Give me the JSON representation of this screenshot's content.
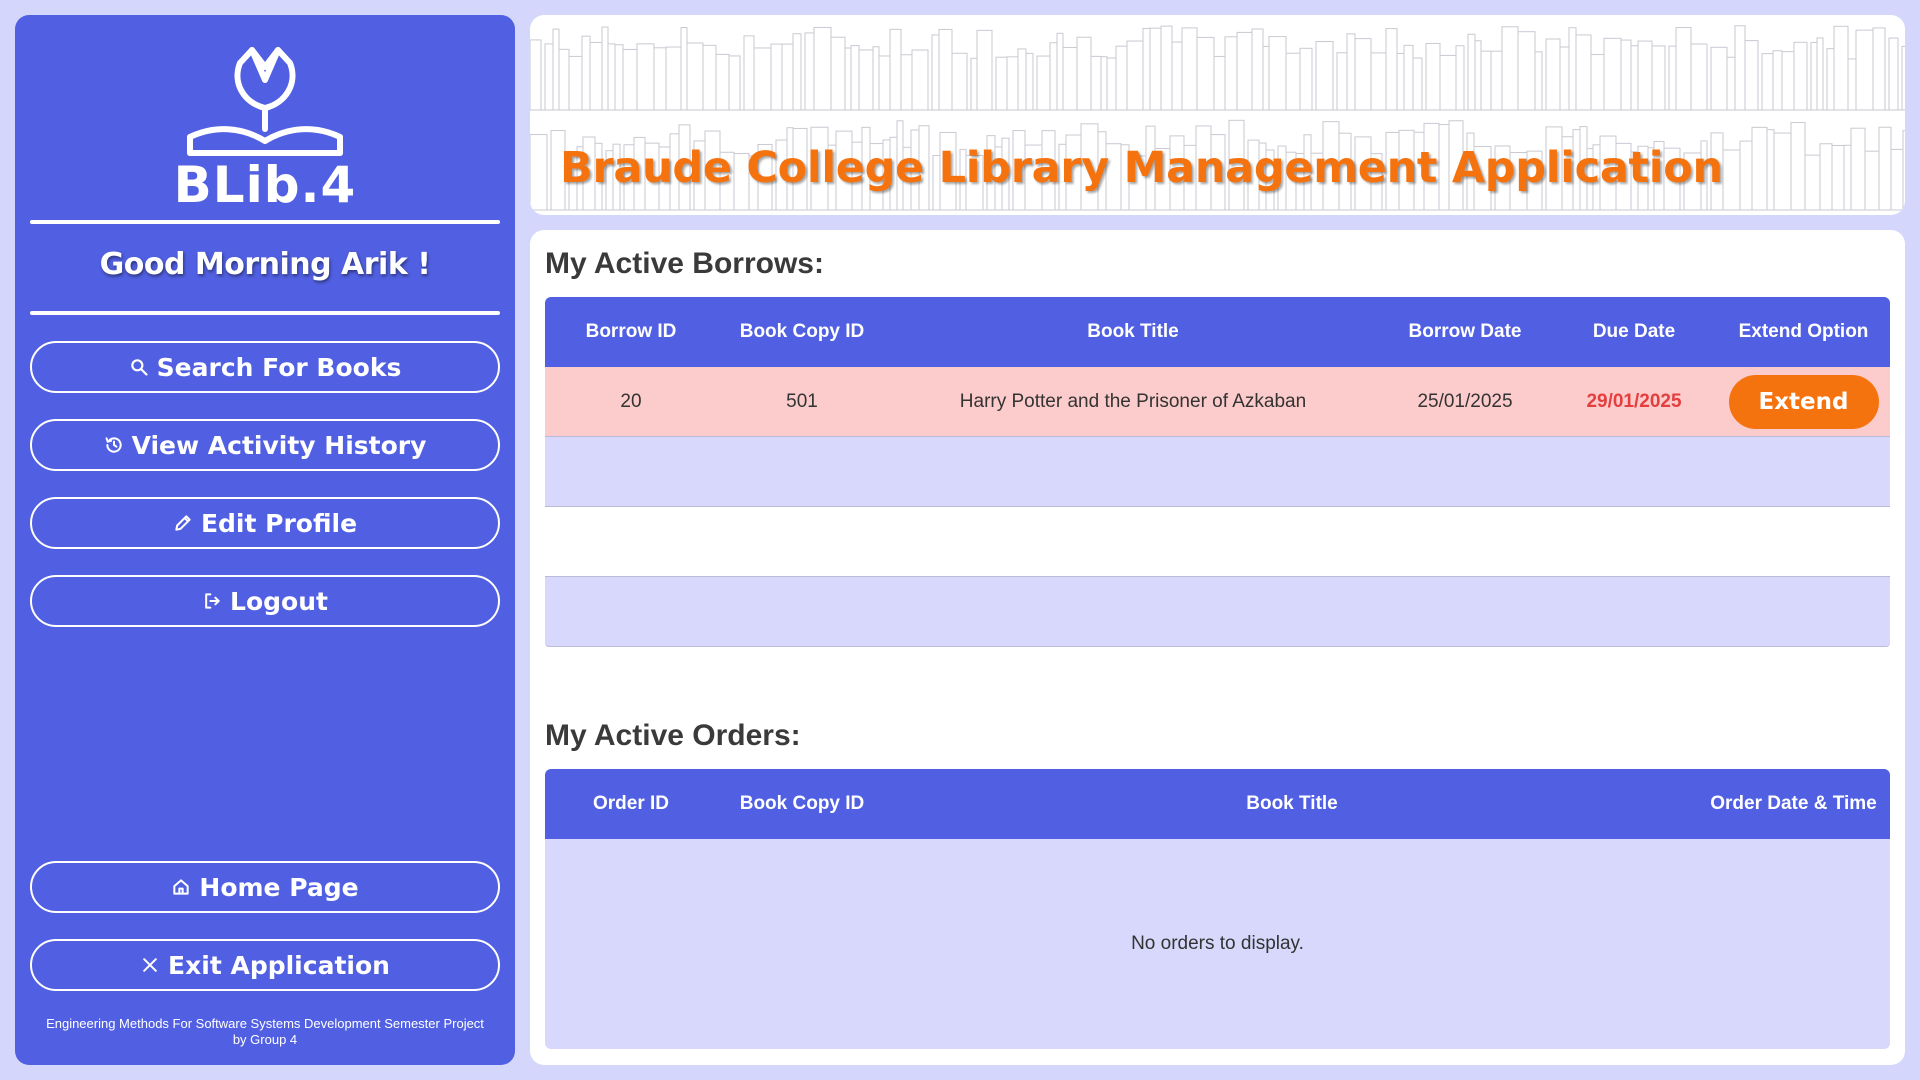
{
  "sidebar": {
    "logo_text": "BLib.4",
    "greeting": "Good Morning Arik !",
    "nav": [
      {
        "label": "Search For Books",
        "icon": "search-icon"
      },
      {
        "label": "View Activity History",
        "icon": "history-icon"
      },
      {
        "label": "Edit Profile",
        "icon": "pencil-icon"
      },
      {
        "label": "Logout",
        "icon": "logout-icon"
      }
    ],
    "bottom_nav": [
      {
        "label": "Home Page",
        "icon": "home-icon"
      },
      {
        "label": "Exit Application",
        "icon": "close-icon"
      }
    ],
    "footer_line1": "Engineering Methods For Software Systems Development Semester Project",
    "footer_line2": "by Group 4"
  },
  "banner": {
    "title": "Braude College Library Management Application"
  },
  "borrows": {
    "title": "My Active Borrows:",
    "columns": [
      "Borrow ID",
      "Book Copy ID",
      "Book Title",
      "Borrow Date",
      "Due Date",
      "Extend Option"
    ],
    "rows": [
      {
        "borrow_id": "20",
        "book_copy_id": "501",
        "book_title": "Harry Potter and the Prisoner of Azkaban",
        "borrow_date": "25/01/2025",
        "due_date": "29/01/2025",
        "action": "Extend"
      }
    ]
  },
  "orders": {
    "title": "My Active Orders:",
    "columns": [
      "Order ID",
      "Book Copy ID",
      "Book Title",
      "Order Date & Time"
    ],
    "empty_text": "No orders to display."
  },
  "colors": {
    "sidebar": "#5160e2",
    "accent": "#f5730f",
    "overdue": "#e53e3e",
    "page_bg": "#d4d6fb"
  }
}
